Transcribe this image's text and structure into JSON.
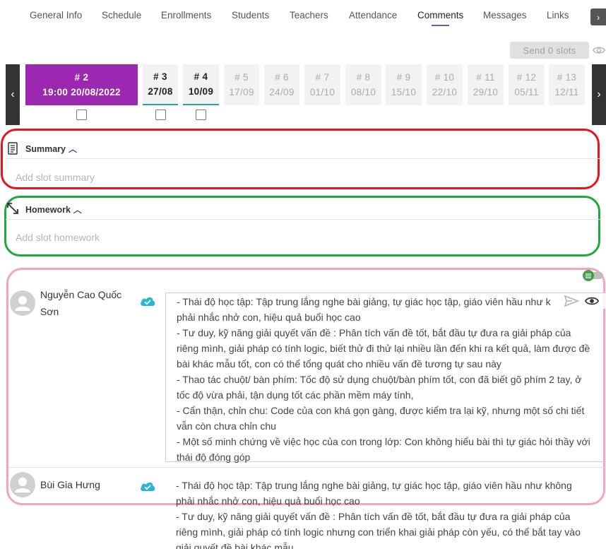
{
  "tabs": [
    {
      "label": "General Info"
    },
    {
      "label": "Schedule"
    },
    {
      "label": "Enrollments"
    },
    {
      "label": "Students"
    },
    {
      "label": "Teachers"
    },
    {
      "label": "Attendance"
    },
    {
      "label": "Comments",
      "active": true
    },
    {
      "label": "Messages"
    },
    {
      "label": "Links"
    }
  ],
  "toolbar": {
    "send_label": "Send 0 slots"
  },
  "slots": [
    {
      "num": "# 2",
      "line2": "19:00  20/08/2022",
      "state": "current"
    },
    {
      "num": "# 3",
      "line2": "27/08",
      "state": "done"
    },
    {
      "num": "# 4",
      "line2": "10/09",
      "state": "done"
    },
    {
      "num": "# 5",
      "line2": "17/09",
      "state": "future"
    },
    {
      "num": "# 6",
      "line2": "24/09",
      "state": "future"
    },
    {
      "num": "# 7",
      "line2": "01/10",
      "state": "future"
    },
    {
      "num": "# 8",
      "line2": "08/10",
      "state": "future"
    },
    {
      "num": "# 9",
      "line2": "15/10",
      "state": "future"
    },
    {
      "num": "# 10",
      "line2": "22/10",
      "state": "future"
    },
    {
      "num": "# 11",
      "line2": "29/10",
      "state": "future"
    },
    {
      "num": "# 12",
      "line2": "05/11",
      "state": "future"
    },
    {
      "num": "# 13",
      "line2": "12/11",
      "state": "future"
    }
  ],
  "summary": {
    "title": "Summary",
    "placeholder": "Add slot summary"
  },
  "homework": {
    "title": "Homework",
    "placeholder": "Add slot homework"
  },
  "students": [
    {
      "name_line1": "Nguyễn Cao Quốc",
      "name_line2": "Sơn",
      "comment": [
        "- Thái độ học tập: Tập trung lắng nghe bài giảng, tự giác học tập, giáo viên hầu như k",
        "phải nhắc nhở con, hiệu quả buổi học cao",
        "- Tư duy, kỹ năng giải quyết vấn đề : Phân tích vấn đề tốt, bắt đầu tự đưa ra giải pháp của",
        "riêng mình, giải pháp có tính logic, biết thử đi thử lại nhiều lần đến khi ra kết quả, làm được đề",
        "bài khác mẫu tốt, con có thể tổng quát cho nhiều vấn đề tương tự sau này",
        "- Thao tác chuột/ bàn phím: Tốc độ sử dụng chuột/bàn phím tốt, con đã biết gõ phím 2 tay, ở",
        "tốc độ vừa phải, tận dụng tốt các phần mềm máy tính,",
        "- Cẩn thận, chỉn chu: Code của con khá gọn gàng, được kiểm tra lại kỹ, nhưng một số chi tiết",
        "vẫn còn chưa chỉn chu",
        "- Một số minh chứng về việc học của con trong lớp: Con không hiểu bài thì tự giác hỏi thầy với",
        "thái độ đóng góp"
      ]
    },
    {
      "name_line1": "Bùi Gia Hưng",
      "comment": [
        "- Thái độ học tập: Tập trung lắng nghe bài giảng, tự giác học tập, giáo viên hầu như không",
        "phải nhắc nhở con, hiệu quả buổi học cao",
        "- Tư duy, kỹ năng giải quyết vấn đề : Phân tích vấn đề tốt, bắt đầu tự đưa ra giải pháp của",
        "riêng mình, giải pháp có tính logic nhưng con triển khai giải pháp còn yếu, có thể bắt tay vào",
        "giải quyết đề bài khác mẫu"
      ]
    }
  ],
  "colors": {
    "current_slot": "#9c27b0",
    "done_underline": "#26a69a",
    "cloud": "#29b6d6",
    "summary_frame": "#e8141d",
    "homework_frame": "#1fa83f",
    "students_frame": "#f4a3c3"
  }
}
